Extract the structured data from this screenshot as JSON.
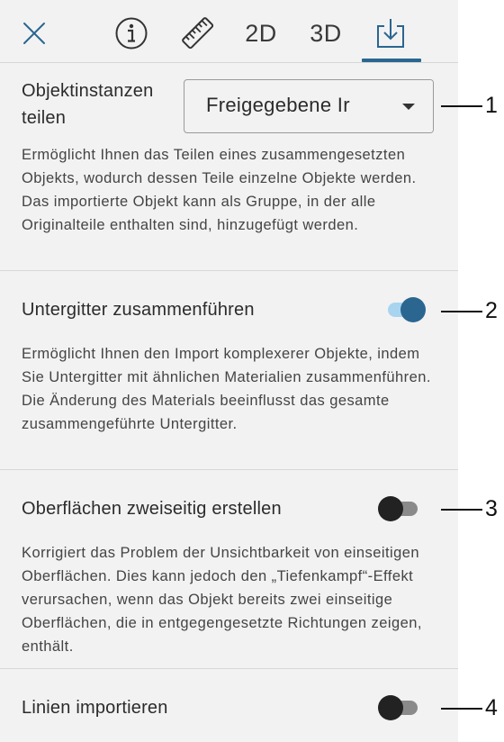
{
  "tabs": {
    "close_label": "close",
    "dim_2d": "2D",
    "dim_3d": "3D"
  },
  "sections": [
    {
      "label_line1": "Objektinstanzen",
      "label_line2": "teilen",
      "select_value": "Freigegebene Ir",
      "description": "Ermöglicht Ihnen das Teilen eines zusammengesetzten Objekts, wodurch dessen Teile einzelne Objekte werden. Das importierte Objekt kann als Gruppe, in der alle Originalteile enthalten sind, hinzugefügt werden.",
      "callout": "1"
    },
    {
      "label": "Untergitter zusammenführen",
      "toggle_state": "on",
      "description": "Ermöglicht Ihnen den Import komplexerer Objekte, indem Sie Untergitter mit ähnlichen Materialien zusammenführen. Die Änderung des Materials beeinflusst das gesamte zusammengeführte Untergitter.",
      "callout": "2"
    },
    {
      "label": "Oberflächen zweiseitig erstellen",
      "toggle_state": "off",
      "description": "Korrigiert das Problem der Unsichtbarkeit von einseitigen Oberflächen. Dies kann jedoch den „Tiefenkampf“-Effekt verursachen, wenn das Objekt bereits zwei einseitige Oberflächen, die in entgegengesetzte Richtungen zeigen, enthält.",
      "callout": "3"
    },
    {
      "label": "Linien importieren",
      "toggle_state": "off",
      "callout": "4"
    }
  ],
  "colors": {
    "accent": "#2a6690",
    "accent_light": "#a8d4ef",
    "panel_bg": "#f2f2f2"
  }
}
